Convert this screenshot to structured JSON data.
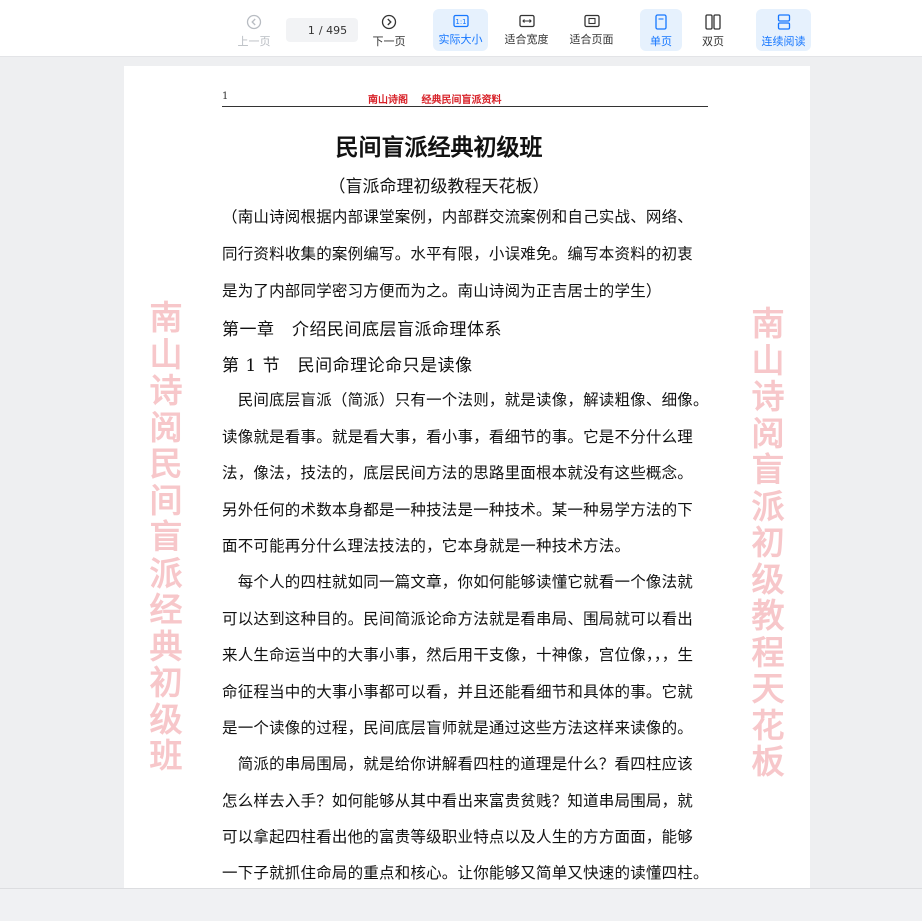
{
  "toolbar": {
    "prev_page": "上一页",
    "current_page": "1",
    "page_total": "/ 495",
    "next_page": "下一页",
    "actual_size": "实际大小",
    "fit_width": "适合宽度",
    "fit_page": "适合页面",
    "single_page": "单页",
    "double_page": "双页",
    "continuous": "连续阅读",
    "accent_color": "#1677ff"
  },
  "page": {
    "number": "1",
    "running_title": "南山诗阁　 经典民间盲派资料",
    "title": "民间盲派经典初级班",
    "subtitle": "（盲派命理初级教程天花板）",
    "lines": [
      "（南山诗阅根据内部课堂案例，内部群交流案例和自己实战、网络、",
      "同行资料收集的案例编写。水平有限，小误难免。编写本资料的初衷",
      "是为了内部同学密习方便而为之。南山诗阅为正吉居士的学生）",
      "第一章　介绍民间底层盲派命理体系",
      "第 1 节　民间命理论命只是读像",
      "　民间底层盲派（简派）只有一个法则，就是读像，解读粗像、细像。",
      "读像就是看事。就是看大事，看小事，看细节的事。它是不分什么理",
      "法，像法，技法的，底层民间方法的思路里面根本就没有这些概念。",
      "另外任何的术数本身都是一种技法是一种技术。某一种易学方法的下",
      "面不可能再分什么理法技法的，它本身就是一种技术方法。",
      "　每个人的四柱就如同一篇文章，你如何能够读懂它就看一个像法就",
      "可以达到这种目的。民间简派论命方法就是看串局、围局就可以看出",
      "来人生命运当中的大事小事，然后用干支像，十神像，宫位像，，，生",
      "命征程当中的大事小事都可以看，并且还能看细节和具体的事。它就",
      "是一个读像的过程，民间底层盲师就是通过这些方法这样来读像的。",
      "　简派的串局围局，就是给你讲解看四柱的道理是什么？看四柱应该",
      "怎么样去入手？如何能够从其中看出来富贵贫贱？知道串局围局，就",
      "可以拿起四柱看出他的富贵等级职业特点以及人生的方方面面，能够",
      "一下子就抓住命局的重点和核心。让你能够又简单又快速的读懂四柱。"
    ],
    "watermark_left": "南山诗阅　民间盲派经典初级班",
    "watermark_right": "南山诗阅　盲派初级教程天花板"
  }
}
